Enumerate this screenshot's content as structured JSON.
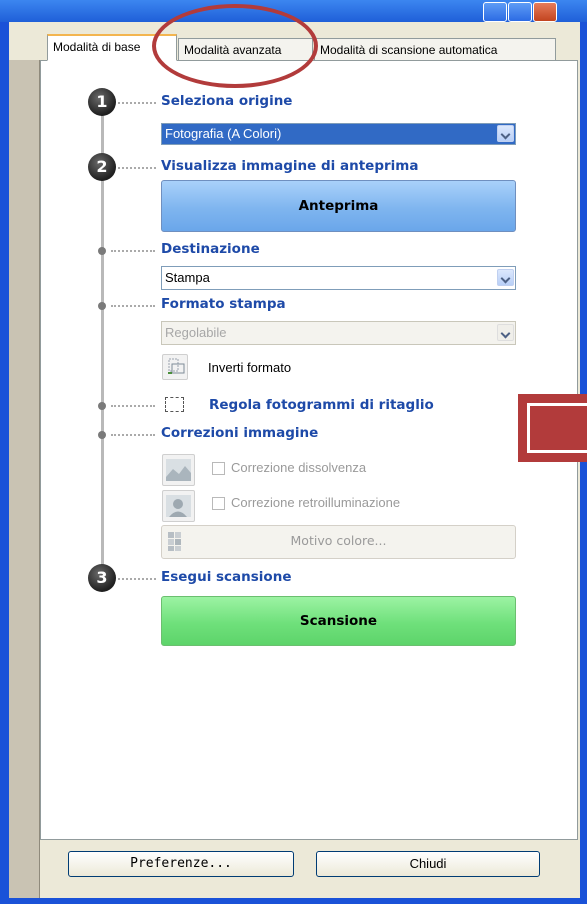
{
  "tabs": [
    {
      "label": "Modalità di base"
    },
    {
      "label": "Modalità avanzata"
    },
    {
      "label": "Modalità di scansione automatica"
    }
  ],
  "steps": {
    "step1": {
      "number": "1",
      "heading": "Seleziona origine"
    },
    "step2": {
      "number": "2",
      "heading": "Visualizza immagine di anteprima"
    },
    "step3": {
      "number": "3",
      "heading": "Esegui scansione"
    }
  },
  "source": {
    "value": "Fotografia (A Colori)"
  },
  "preview_button": {
    "label": "Anteprima"
  },
  "destination": {
    "heading": "Destinazione",
    "value": "Stampa"
  },
  "print_format": {
    "heading": "Formato stampa",
    "value": "Regolabile",
    "invert_label": "Inverti formato"
  },
  "crop_frames": {
    "label": "Regola fotogrammi di ritaglio"
  },
  "image_corrections": {
    "heading": "Correzioni immagine",
    "fade_label": "Correzione dissolvenza",
    "backlight_label": "Correzione retroilluminazione",
    "color_pattern_label": "Motivo colore..."
  },
  "scan_button": {
    "label": "Scansione"
  },
  "footer": {
    "preferences_label": "Preferenze...",
    "close_label": "Chiudi"
  },
  "colors": {
    "heading": "#1e4aa8",
    "preview": "#7fb5ef",
    "scan": "#6fe07b",
    "annotation": "#b23b3b"
  }
}
